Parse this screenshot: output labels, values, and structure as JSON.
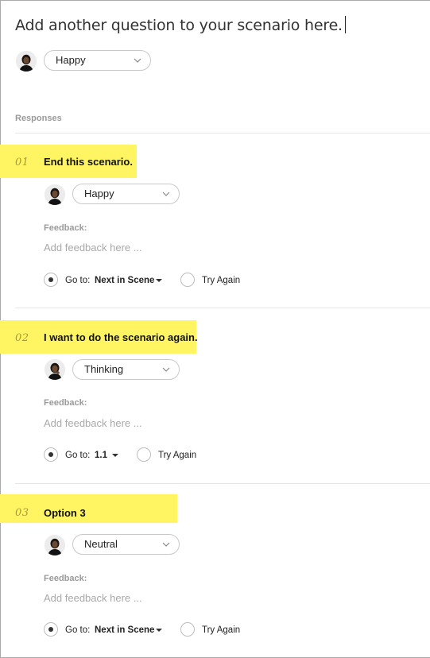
{
  "question": {
    "text": "Add another question to your scenario here."
  },
  "top_emotion": "Happy",
  "responses_label": "Responses",
  "responses": [
    {
      "number": "01",
      "text": "End this scenario.",
      "emotion": "Happy",
      "feedback_label": "Feedback:",
      "feedback_placeholder": "Add feedback here ...",
      "goto_label": "Go to:",
      "goto_value": "Next in Scene",
      "goto_selected": true,
      "try_again_label": "Try Again"
    },
    {
      "number": "02",
      "text": "I want to do the scenario again.",
      "emotion": "Thinking",
      "feedback_label": "Feedback:",
      "feedback_placeholder": "Add feedback here ...",
      "goto_label": "Go to:",
      "goto_value": "1.1",
      "goto_selected": true,
      "try_again_label": "Try Again"
    },
    {
      "number": "03",
      "text": "Option 3",
      "emotion": "Neutral",
      "feedback_label": "Feedback:",
      "feedback_placeholder": "Add feedback here ...",
      "goto_label": "Go to:",
      "goto_value": "Next in Scene",
      "goto_selected": true,
      "try_again_label": "Try Again"
    }
  ],
  "colors": {
    "highlight": "#fff563",
    "number": "#a89a37",
    "muted": "#9a9a9a"
  }
}
